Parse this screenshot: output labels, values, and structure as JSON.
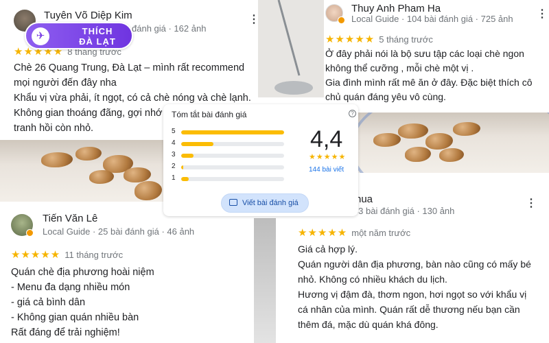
{
  "colors": {
    "star": "#f6b400",
    "bar": "#fbbc04",
    "accent": "#1a73e8",
    "brand_purple": "#7b3fe4"
  },
  "logo": {
    "line1": "THÍCH",
    "line2": "ĐÀ LẠT"
  },
  "reviews": [
    {
      "author": "Tuyên Võ Diệp Kim",
      "meta_tail": "đánh giá · 162 ảnh",
      "stars": "★★★★★",
      "time": "8 tháng trước",
      "text": "Chè 26 Quang Trung, Đà Lạt – mình rất recommend mọi người đến đây nha\nKhẩu vị vừa phải, ít ngọt, có cả chè nóng và chè lạnh.\nKhông gian thoáng đãng, gợi nhớ l\ntranh  hồi còn nhỏ."
    },
    {
      "author": "Thuy Anh Pham Ha",
      "meta": "Local Guide · 104 bài đánh giá · 725 ảnh",
      "stars": "★★★★★",
      "time": "5 tháng trước",
      "text": "Ở đây phải nói là bộ sưu tập các loại chè ngon không thể cưỡng ,  mỗi chè một vị .\nGia đình mình rất mê ăn ở đây. Đặc biệt thích cô chủ quán đáng yêu vô cùng."
    },
    {
      "author": "Tiến Văn Lê",
      "meta": "Local Guide · 25 bài đánh giá · 46 ảnh",
      "stars": "★★★★★",
      "time": "11 tháng trước",
      "text": "Quán chè địa phương hoài niệm\n- Menu đa dạng nhiều món\n- giá cả bình dân\n- Không gian quán nhiều bàn\nRất đáng để trải nghiệm!"
    },
    {
      "author": "nua",
      "meta": "Local Guide · 43 bài đánh giá · 130 ảnh",
      "stars": "★★★★★",
      "time": "một năm trước",
      "text": "Giá cả hợp lý.\nQuán người dân địa phương, bàn nào cũng có mấy bé nhỏ. Không có nhiều khách du lịch.\nHương vị đậm đà, thơm ngon, hơi ngọt so với khẩu vị cá nhân của mình. Quán rất dễ thương nếu bạn cần thêm đá, mặc dù quán khá đông."
    }
  ],
  "summary": {
    "title": "Tóm tắt bài đánh giá",
    "help_icon": "help-circle-icon",
    "rating": "4,4",
    "stars": "★★★★★",
    "count": "144 bài viết",
    "distribution": [
      {
        "label": "5",
        "fraction": 1.0
      },
      {
        "label": "4",
        "fraction": 0.31
      },
      {
        "label": "3",
        "fraction": 0.12
      },
      {
        "label": "2",
        "fraction": 0.02
      },
      {
        "label": "1",
        "fraction": 0.07
      }
    ],
    "write_button": "Viết bài đánh giá",
    "write_icon": "review-icon"
  }
}
